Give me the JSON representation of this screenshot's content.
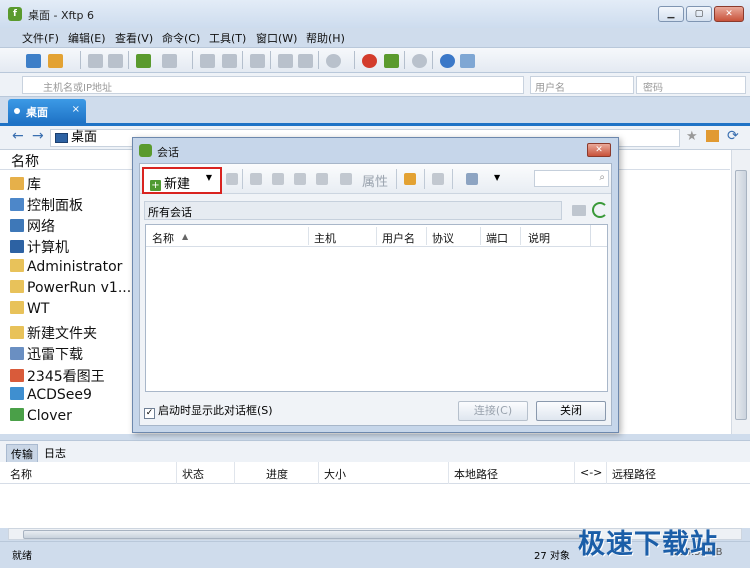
{
  "window": {
    "title": "桌面 - Xftp 6",
    "icon": "xftp-app-icon"
  },
  "menu": [
    "文件(F)",
    "编辑(E)",
    "查看(V)",
    "命令(C)",
    "工具(T)",
    "窗口(W)",
    "帮助(H)"
  ],
  "address_bar": {
    "host_placeholder": "主机名或IP地址",
    "user_placeholder": "用户名",
    "password_placeholder": "密码"
  },
  "tab": {
    "label": "桌面",
    "close": "×"
  },
  "nav": {
    "path": "桌面"
  },
  "file_pane": {
    "column": "名称",
    "items": [
      "库",
      "控制面板",
      "网络",
      "计算机",
      "Administrator",
      "PowerRun v1....",
      "WT",
      "新建文件夹",
      "迅雷下载",
      "2345看图王",
      "ACDSee9",
      "Clover"
    ]
  },
  "bottom_tabs": [
    "传输",
    "日志"
  ],
  "transfer_columns": [
    "名称",
    "状态",
    "进度",
    "大小",
    "本地路径",
    "<->",
    "远程路径"
  ],
  "status": {
    "left": "就绪",
    "count": "27 对象",
    "size": "194.55MB"
  },
  "watermark": "极速下载站",
  "dialog": {
    "title": "会话",
    "close": "✕",
    "new_button": "新建",
    "attr_label": "属性",
    "path": "所有会话",
    "columns": [
      "名称",
      "主机",
      "用户名",
      "协议",
      "端口",
      "说明"
    ],
    "startup_checkbox": "启动时显示此对话框(S)",
    "connect_button": "连接(C)",
    "close_button": "关闭"
  },
  "colors": {
    "accent": "#1f73c6",
    "new_button_highlight": "#d9231f",
    "watermark": "#1b5ea8"
  }
}
